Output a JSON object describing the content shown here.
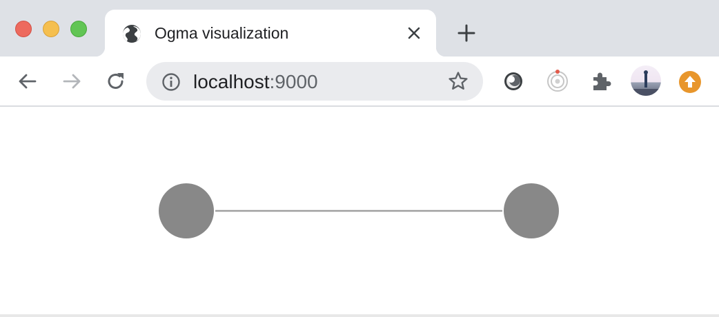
{
  "window": {
    "controls": [
      "close",
      "minimize",
      "maximize"
    ]
  },
  "tab": {
    "title": "Ogma visualization",
    "favicon": "globe-icon",
    "close_icon": "close-icon"
  },
  "toolbar": {
    "back_icon": "arrow-back-icon",
    "forward_icon": "arrow-forward-icon",
    "reload_icon": "reload-icon",
    "address": {
      "host": "localhost",
      "port": ":9000",
      "info_icon": "info-icon",
      "bookmark_icon": "star-icon"
    },
    "extensions": [
      "lens-extension-icon",
      "target-extension-icon",
      "puzzle-extensions-icon"
    ],
    "profile": "avatar",
    "update_icon": "update-arrow-icon"
  },
  "graph": {
    "nodes": [
      {
        "id": "n0",
        "color": "#888888"
      },
      {
        "id": "n1",
        "color": "#888888"
      }
    ],
    "edges": [
      {
        "source": "n0",
        "target": "n1",
        "color": "#a0a0a0"
      }
    ]
  },
  "colors": {
    "tab_strip": "#dee1e6",
    "omnibox": "#eaebee",
    "node": "#888888",
    "edge": "#a0a0a0",
    "update_badge": "#e8962c"
  }
}
